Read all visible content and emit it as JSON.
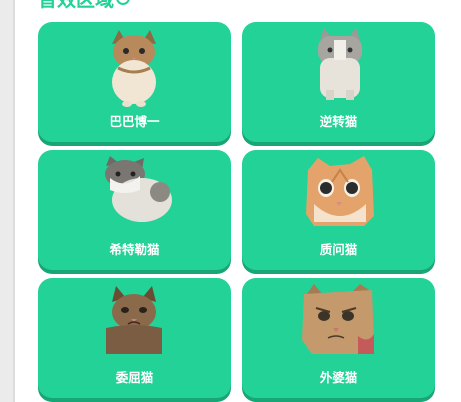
{
  "section": {
    "title": "音效区域",
    "info_icon": "info-circle-icon"
  },
  "cards": [
    {
      "label": "巴巴博一",
      "image": "orange-tabby-cat-standing"
    },
    {
      "label": "逆转猫",
      "image": "gray-white-cat-standing"
    },
    {
      "label": "希特勒猫",
      "image": "gray-white-cat-hunched"
    },
    {
      "label": "质问猫",
      "image": "orange-cat-surprised-face"
    },
    {
      "label": "委屈猫",
      "image": "tabby-cat-sad-face"
    },
    {
      "label": "外婆猫",
      "image": "orange-cat-grumpy-face"
    }
  ],
  "colors": {
    "accent": "#23d296",
    "accent_dark": "#18a676",
    "label_text": "#ffffff"
  }
}
